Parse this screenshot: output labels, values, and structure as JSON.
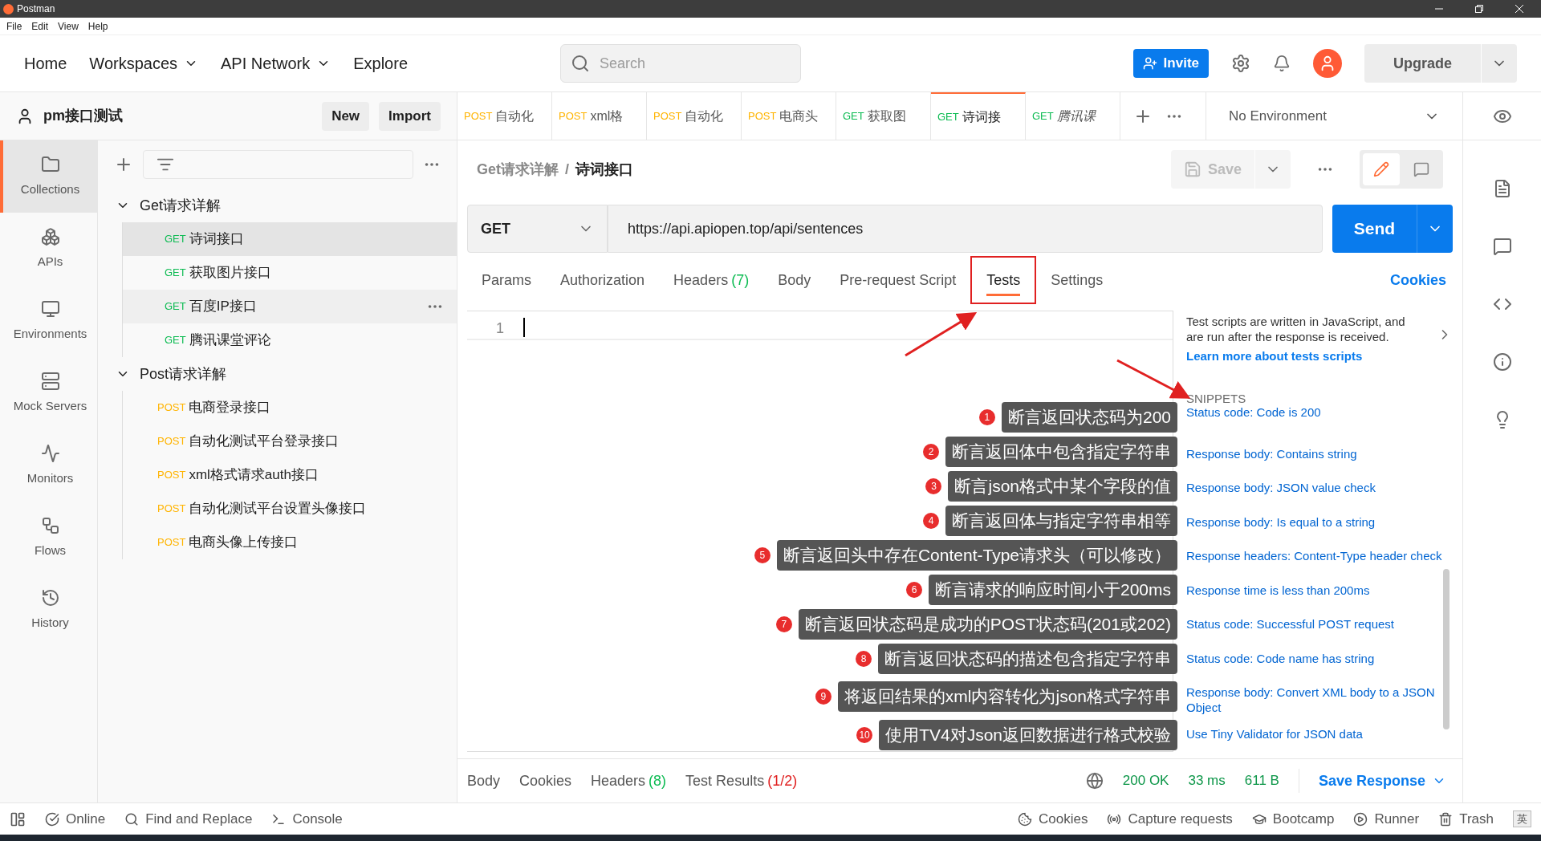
{
  "window": {
    "title": "Postman",
    "menu": [
      "File",
      "Edit",
      "View",
      "Help"
    ]
  },
  "header": {
    "nav": [
      {
        "label": "Home",
        "dropdown": false
      },
      {
        "label": "Workspaces",
        "dropdown": true
      },
      {
        "label": "API Network",
        "dropdown": true
      },
      {
        "label": "Explore",
        "dropdown": false
      }
    ],
    "search": {
      "placeholder": "Search"
    },
    "invite": "Invite",
    "upgrade": "Upgrade"
  },
  "workspace": {
    "name": "pm接口测试",
    "buttons": [
      "New",
      "Import"
    ]
  },
  "sidebar": {
    "items": [
      {
        "label": "Collections",
        "selected": true
      },
      {
        "label": "APIs",
        "selected": false
      },
      {
        "label": "Environments",
        "selected": false
      },
      {
        "label": "Mock Servers",
        "selected": false
      },
      {
        "label": "Monitors",
        "selected": false
      },
      {
        "label": "Flows",
        "selected": false
      },
      {
        "label": "History",
        "selected": false
      }
    ]
  },
  "tree": [
    {
      "name": "Get请求详解",
      "expanded": true,
      "children": [
        {
          "method": "GET",
          "name": "诗词接口",
          "selected": true,
          "hovered": false
        },
        {
          "method": "GET",
          "name": "获取图片接口",
          "selected": false,
          "hovered": false
        },
        {
          "method": "GET",
          "name": "百度IP接口",
          "selected": false,
          "hovered": true
        },
        {
          "method": "GET",
          "name": "腾讯课堂评论",
          "selected": false,
          "hovered": false
        }
      ]
    },
    {
      "name": "Post请求详解",
      "expanded": true,
      "children": [
        {
          "method": "POST",
          "name": "电商登录接口",
          "selected": false,
          "hovered": false
        },
        {
          "method": "POST",
          "name": "自动化测试平台登录接口",
          "selected": false,
          "hovered": false
        },
        {
          "method": "POST",
          "name": "xml格式请求auth接口",
          "selected": false,
          "hovered": false
        },
        {
          "method": "POST",
          "name": "自动化测试平台设置头像接口",
          "selected": false,
          "hovered": false
        },
        {
          "method": "POST",
          "name": "电商头像上传接口",
          "selected": false,
          "hovered": false
        }
      ]
    }
  ],
  "request_tabs": [
    {
      "method": "POST",
      "name": "自动化",
      "selected": false,
      "preview": false
    },
    {
      "method": "POST",
      "name": "xml格",
      "selected": false,
      "preview": false
    },
    {
      "method": "POST",
      "name": "自动化",
      "selected": false,
      "preview": false
    },
    {
      "method": "POST",
      "name": "电商头",
      "selected": false,
      "preview": false
    },
    {
      "method": "GET",
      "name": "获取图",
      "selected": false,
      "preview": false
    },
    {
      "method": "GET",
      "name": "诗词接",
      "selected": true,
      "preview": false
    },
    {
      "method": "GET",
      "name": "腾讯课",
      "selected": false,
      "preview": true
    }
  ],
  "environment": "No Environment",
  "breadcrumb": {
    "parent": "Get请求详解",
    "separator": "/",
    "current": "诗词接口"
  },
  "save": "Save",
  "view_toggle": [
    {
      "selected": true
    },
    {
      "selected": false
    }
  ],
  "request": {
    "method": "GET",
    "url": "https://api.apiopen.top/api/sentences",
    "send": "Send"
  },
  "request_sections": [
    {
      "label": "Params",
      "selected": false
    },
    {
      "label": "Authorization",
      "selected": false
    },
    {
      "label": "Headers",
      "count": "(7)",
      "selected": false
    },
    {
      "label": "Body",
      "selected": false
    },
    {
      "label": "Pre-request Script",
      "selected": false
    },
    {
      "label": "Tests",
      "selected": true
    },
    {
      "label": "Settings",
      "selected": false
    }
  ],
  "cookies_link": "Cookies",
  "editor": {
    "line_numbers": [
      "1"
    ]
  },
  "tests_help": {
    "text": "Test scripts are written in JavaScript, and are run after the response is received.",
    "link": "Learn more about tests scripts"
  },
  "snippets": {
    "title": "SNIPPETS",
    "items": [
      "Status code: Code is 200",
      "Response body: Contains string",
      "Response body: JSON value check",
      "Response body: Is equal to a string",
      "Response headers: Content-Type header check",
      "Response time is less than 200ms",
      "Status code: Successful POST request",
      "Status code: Code name has string",
      "Response body: Convert XML body to a JSON Object",
      "Use Tiny Validator for JSON data"
    ]
  },
  "annotations": [
    {
      "number": "1",
      "text": "断言返回状态码为200"
    },
    {
      "number": "2",
      "text": "断言返回体中包含指定字符串"
    },
    {
      "number": "3",
      "text": "断言json格式中某个字段的值"
    },
    {
      "number": "4",
      "text": "断言返回体与指定字符串相等"
    },
    {
      "number": "5",
      "text": "断言返回头中存在Content-Type请求头（可以修改）"
    },
    {
      "number": "6",
      "text": "断言请求的响应时间小于200ms"
    },
    {
      "number": "7",
      "text": "断言返回状态码是成功的POST状态码(201或202)"
    },
    {
      "number": "8",
      "text": "断言返回状态码的描述包含指定字符串"
    },
    {
      "number": "9",
      "text": "将返回结果的xml内容转化为json格式字符串"
    },
    {
      "number": "10",
      "text": "使用TV4对Json返回数据进行格式校验"
    }
  ],
  "response": {
    "tabs": [
      {
        "label": "Body",
        "kind": "plain"
      },
      {
        "label": "Cookies",
        "kind": "plain"
      },
      {
        "label": "Headers",
        "count": "(8)",
        "kind": "count"
      },
      {
        "label": "Test Results",
        "count": "(1/2)",
        "kind": "failures"
      }
    ],
    "status": "200 OK",
    "time": "33 ms",
    "size": "611 B",
    "save": "Save Response"
  },
  "status_bar": {
    "left": [
      "Online",
      "Find and Replace",
      "Console"
    ],
    "right": [
      "Cookies",
      "Capture requests",
      "Bootcamp",
      "Runner",
      "Trash"
    ],
    "ime": "英"
  }
}
